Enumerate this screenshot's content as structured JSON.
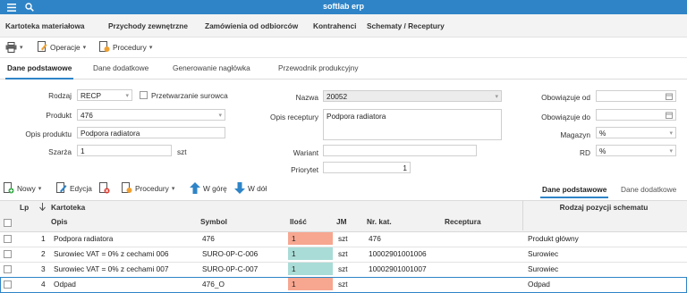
{
  "app": {
    "title": "softlab erp"
  },
  "menu": [
    "Kartoteka materiałowa",
    "Przychody zewnętrzne",
    "Zamówienia od odbiorców",
    "Kontrahenci",
    "Schematy / Receptury"
  ],
  "toolbar": {
    "operations": "Operacje",
    "procedures": "Procedury"
  },
  "tabs": [
    "Dane podstawowe",
    "Dane dodatkowe",
    "Generowanie nagłówka",
    "Przewodnik produkcyjny"
  ],
  "form": {
    "rodzaj": {
      "label": "Rodzaj",
      "value": "RECP"
    },
    "przetwarzanie": {
      "label": "Przetwarzanie surowca"
    },
    "produkt": {
      "label": "Produkt",
      "value": "476"
    },
    "opis_produktu": {
      "label": "Opis produktu",
      "value": "Podpora radiatora"
    },
    "szarza": {
      "label": "Szarża",
      "value": "1",
      "unit": "szt"
    },
    "nazwa": {
      "label": "Nazwa",
      "value": "20052"
    },
    "opis_receptury": {
      "label": "Opis receptury",
      "value": "Podpora radiatora"
    },
    "wariant": {
      "label": "Wariant",
      "value": ""
    },
    "priorytet": {
      "label": "Priorytet",
      "value": "1"
    },
    "obow_od": {
      "label": "Obowiązuje od",
      "value": ""
    },
    "obow_do": {
      "label": "Obowiązuje do",
      "value": ""
    },
    "magazyn": {
      "label": "Magazyn",
      "value": "%"
    },
    "rd": {
      "label": "RD",
      "value": "%"
    }
  },
  "grid_toolbar": {
    "new": "Nowy",
    "edit": "Edycja",
    "procedures": "Procedury",
    "up": "W górę",
    "down": "W dół",
    "tabs": [
      "Dane podstawowe",
      "Dane dodatkowe"
    ]
  },
  "grid": {
    "headers": {
      "lp": "Lp",
      "kartoteka": "Kartoteka",
      "opis": "Opis",
      "symbol": "Symbol",
      "ilosc": "Ilość",
      "jm": "JM",
      "nr_kat": "Nr. kat.",
      "receptura": "Receptura",
      "rodzaj": "Rodzaj pozycji schematu"
    },
    "rows": [
      {
        "lp": "1",
        "opis": "Podpora radiatora",
        "symbol": "476",
        "ilosc": "1",
        "jm": "szt",
        "nr_kat": "476",
        "receptura": "",
        "rodzaj": "Produkt główny",
        "qty_color": "#f7a690"
      },
      {
        "lp": "2",
        "opis": "Surowiec VAT = 0% z cechami 006",
        "symbol": "SURO-0P-C-006",
        "ilosc": "1",
        "jm": "szt",
        "nr_kat": "10002901001006",
        "receptura": "",
        "rodzaj": "Surowiec",
        "qty_color": "#a9dcd6"
      },
      {
        "lp": "3",
        "opis": "Surowiec VAT = 0% z cechami 007",
        "symbol": "SURO-0P-C-007",
        "ilosc": "1",
        "jm": "szt",
        "nr_kat": "10002901001007",
        "receptura": "",
        "rodzaj": "Surowiec",
        "qty_color": "#a9dcd6"
      },
      {
        "lp": "4",
        "opis": "Odpad",
        "symbol": "476_O",
        "ilosc": "1",
        "jm": "szt",
        "nr_kat": "",
        "receptura": "",
        "rodzaj": "Odpad",
        "qty_color": "#f7a690"
      }
    ]
  },
  "colors": {
    "accent": "#2e84c7",
    "qty_main": "#f7a690",
    "qty_material": "#a9dcd6"
  }
}
